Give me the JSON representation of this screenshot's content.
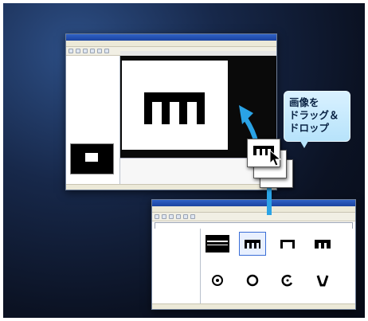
{
  "callout": {
    "text": "画像を\nドラッグ＆\nドロップ"
  },
  "colors": {
    "arrow": "#2aa3e6",
    "background": "#0b1223",
    "bubble": "#c7ebfd"
  },
  "icons": {
    "arrow": "drag-arrow-icon",
    "cursor": "mouse-pointer-icon",
    "thumbs": [
      "barcode-icon",
      "comb-icon",
      "bracket-icon",
      "table-icon",
      "circle-target-icon",
      "circle-icon",
      "circle-open-icon",
      "v-shape-icon"
    ]
  }
}
